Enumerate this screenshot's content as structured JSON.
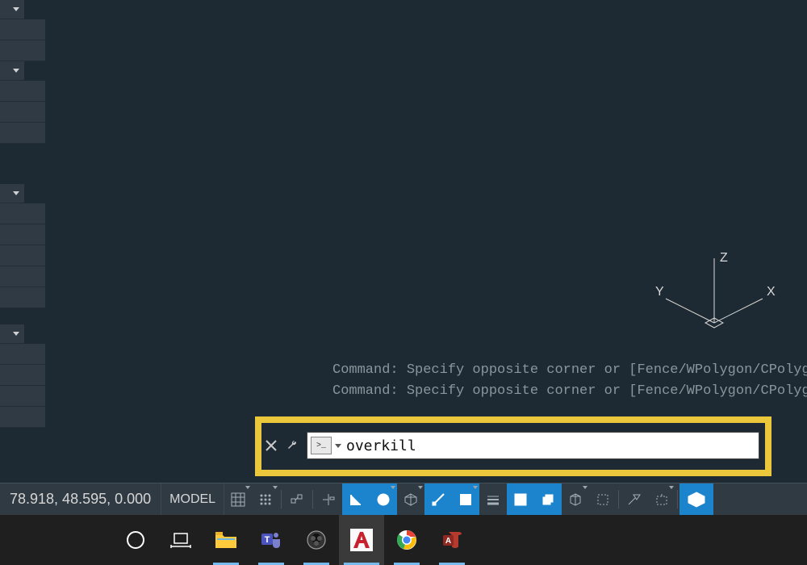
{
  "left_palette": {
    "groups": [
      {
        "rows": 2
      },
      {
        "rows": 3
      },
      {
        "rows": 5
      },
      {
        "rows": 4
      }
    ]
  },
  "ucs": {
    "x_label": "X",
    "y_label": "Y",
    "z_label": "Z"
  },
  "command_history": {
    "lines": [
      "Command: Specify opposite corner or [Fence/WPolygon/CPolyg",
      "Command: Specify opposite corner or [Fence/WPolygon/CPolyg"
    ]
  },
  "command_line": {
    "close_tooltip": "Close",
    "customize_tooltip": "Customize",
    "prompt_glyph": ">_",
    "value": "overkill"
  },
  "status_bar": {
    "coords": "78.918, 48.595, 0.000",
    "model_label": "MODEL",
    "buttons": [
      {
        "name": "grid-display",
        "active": false
      },
      {
        "name": "snap-mode",
        "active": false
      },
      {
        "name": "infer-constraints",
        "active": false
      },
      {
        "name": "dynamic-input",
        "active": false
      },
      {
        "name": "ortho-mode",
        "active": true
      },
      {
        "name": "polar-tracking",
        "active": true
      },
      {
        "name": "isometric-drafting",
        "active": false
      },
      {
        "name": "object-snap-tracking",
        "active": true
      },
      {
        "name": "2d-object-snap",
        "active": true
      },
      {
        "name": "lineweight",
        "active": false
      },
      {
        "name": "transparency",
        "active": true
      },
      {
        "name": "selection-cycling",
        "active": true
      },
      {
        "name": "3d-object-snap",
        "active": false
      },
      {
        "name": "dynamic-ucs",
        "active": false
      },
      {
        "name": "selection-filtering",
        "active": false
      },
      {
        "name": "gizmo",
        "active": false
      },
      {
        "name": "visual-style",
        "active": true
      }
    ]
  },
  "taskbar": {
    "items": [
      {
        "name": "cortana",
        "running": false,
        "active": false
      },
      {
        "name": "task-view",
        "running": false,
        "active": false
      },
      {
        "name": "file-explorer",
        "running": true,
        "active": false
      },
      {
        "name": "teams",
        "running": true,
        "active": false
      },
      {
        "name": "obs",
        "running": true,
        "active": false
      },
      {
        "name": "autocad",
        "running": true,
        "active": true
      },
      {
        "name": "chrome",
        "running": true,
        "active": false
      },
      {
        "name": "access",
        "running": true,
        "active": false
      }
    ]
  }
}
